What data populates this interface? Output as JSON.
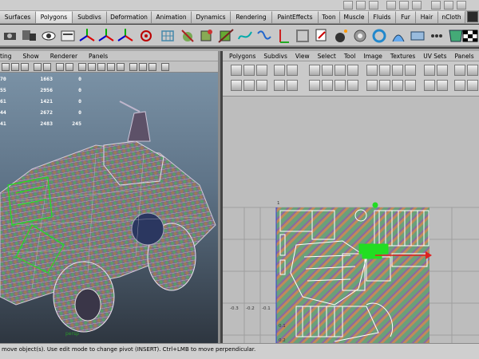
{
  "shelf_tabs": [
    "Surfaces",
    "Polygons",
    "Subdivs",
    "Deformation",
    "Animation",
    "Dynamics",
    "Rendering",
    "PaintEffects",
    "Toon",
    "Muscle",
    "Fluids",
    "Fur",
    "Hair",
    "nCloth"
  ],
  "shelf_active": "Polygons",
  "viewport_left": {
    "menu": [
      "ting",
      "Show",
      "Renderer",
      "Panels"
    ],
    "hud_rows": [
      [
        "70",
        "1663",
        "0"
      ],
      [
        "55",
        "2956",
        "0"
      ],
      [
        "61",
        "1421",
        "0"
      ],
      [
        "44",
        "2672",
        "0"
      ],
      [
        "41",
        "2483",
        "245"
      ]
    ],
    "caption": "persp"
  },
  "uv_editor": {
    "menu": [
      "Polygons",
      "Subdivs",
      "View",
      "Select",
      "Tool",
      "Image",
      "Textures",
      "UV Sets",
      "Panels"
    ],
    "axis_labels_x": [
      "-0.3",
      "-0.2",
      "-0.1"
    ],
    "axis_label_top": "1",
    "axis_labels_y": [
      "0.1",
      "0.2"
    ]
  },
  "status": {
    "text": "move object(s). Use edit mode to change pivot (INSERT). Ctrl+LMB to move perpendicular."
  },
  "colors": {
    "accent_green": "#22dd22",
    "uv_red": "#e02020",
    "uv_blue": "#2f3fd8"
  }
}
